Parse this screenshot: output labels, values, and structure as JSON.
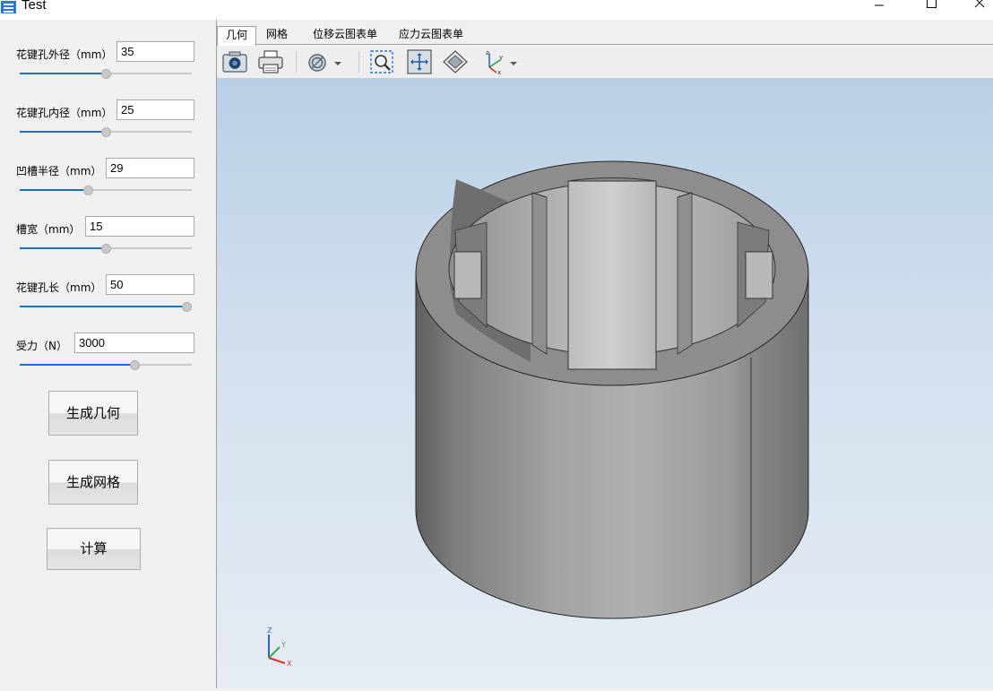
{
  "window": {
    "title": "Test",
    "controls": [
      "minimize",
      "maximize",
      "close"
    ]
  },
  "params": [
    {
      "label": "花键孔外径（mm）",
      "value": "35",
      "slider_fraction": 0.5
    },
    {
      "label": "花键孔内径（mm）",
      "value": "25",
      "slider_fraction": 0.5
    },
    {
      "label": "凹槽半径（mm）",
      "value": "29",
      "slider_fraction": 0.4
    },
    {
      "label": "槽宽（mm）",
      "value": "15",
      "slider_fraction": 0.5
    },
    {
      "label": "花键孔长（mm）",
      "value": "50",
      "slider_fraction": 1.0
    },
    {
      "label": "受力（N）",
      "value": "3000",
      "slider_fraction": 0.67
    }
  ],
  "buttons": {
    "generate_geometry": "生成几何",
    "generate_mesh": "生成网格",
    "compute": "计算"
  },
  "tabs": [
    "几何",
    "网格",
    "位移云图表单",
    "应力云图表单"
  ],
  "active_tab": "几何",
  "toolbar": {
    "icons": [
      "camera-icon",
      "printer-icon",
      "display-mode-icon",
      "zoom-window-icon",
      "fit-all-icon",
      "view-cube-icon",
      "axis-triad-icon"
    ]
  },
  "viewport": {
    "axis_labels": {
      "z": "Z",
      "y": "Y",
      "x": "X"
    },
    "colors": {
      "background_top": "#b9cfe6",
      "background_bottom": "#e6ecf3",
      "part": "#9a9a9a"
    }
  }
}
